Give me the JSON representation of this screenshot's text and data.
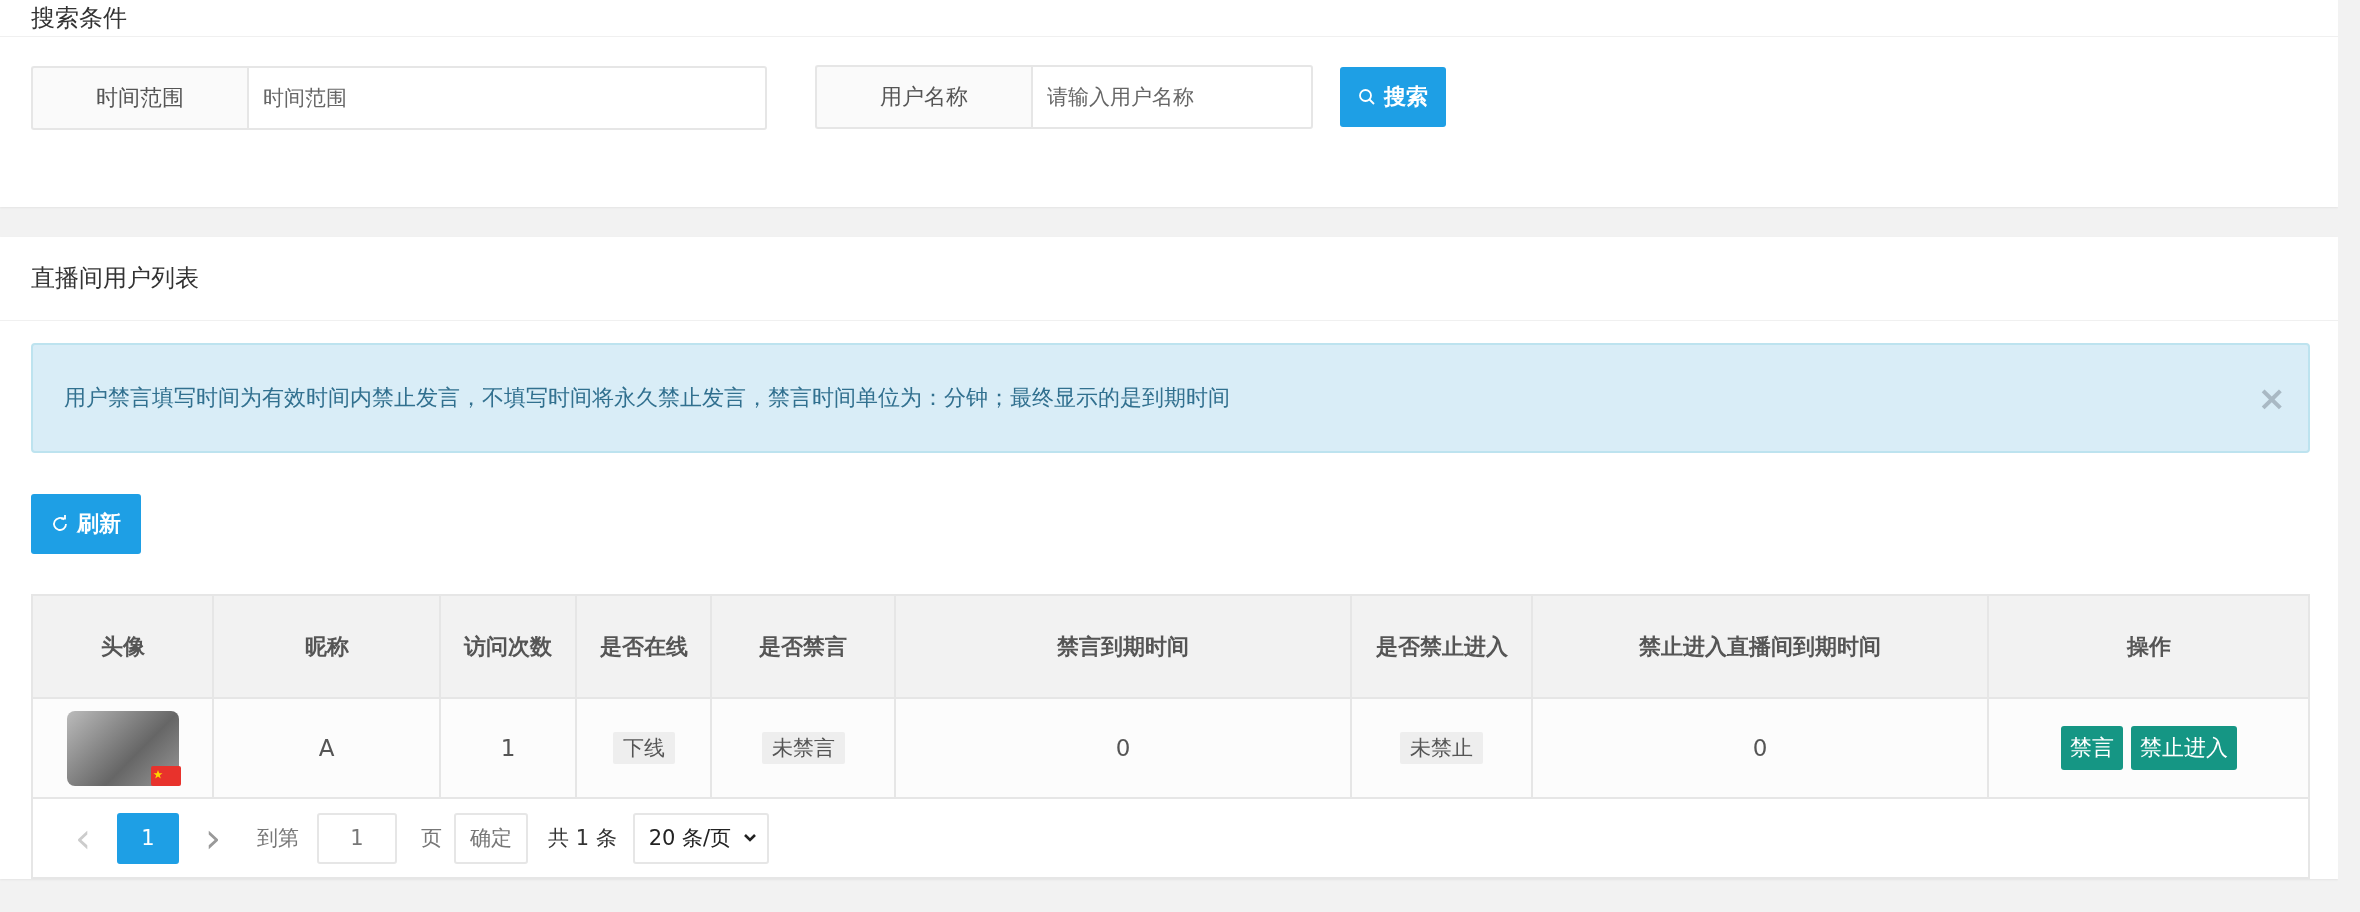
{
  "search_panel": {
    "title": "搜索条件",
    "fields": [
      {
        "label": "时间范围",
        "placeholder": "时间范围"
      },
      {
        "label": "用户名称",
        "placeholder": "请输入用户名称"
      }
    ],
    "search_button": "搜索"
  },
  "list_panel": {
    "title": "直播间用户列表",
    "alert": {
      "text": "用户禁言填写时间为有效时间内禁止发言，不填写时间将永久禁止发言，禁言时间单位为：分钟；最终显示的是到期时间",
      "close": "×"
    },
    "refresh_button": "刷新",
    "table": {
      "columns": [
        "头像",
        "昵称",
        "访问次数",
        "是否在线",
        "是否禁言",
        "禁言到期时间",
        "是否禁止进入",
        "禁止进入直播间到期时间",
        "操作"
      ],
      "rows": [
        {
          "nickname": "A",
          "visits": "1",
          "online": "下线",
          "muted": "未禁言",
          "mute_expiry": "0",
          "banned": "未禁止",
          "ban_expiry": "0",
          "actions": [
            "禁言",
            "禁止进入"
          ]
        }
      ]
    },
    "pagination": {
      "prev": "‹",
      "pages": [
        {
          "label": "1",
          "selected": true
        }
      ],
      "next": "›",
      "goto_label": "到第",
      "goto_value": "1",
      "page_label": "页",
      "confirm": "确定",
      "total": "共 1 条",
      "page_size": "20 条/页"
    }
  }
}
